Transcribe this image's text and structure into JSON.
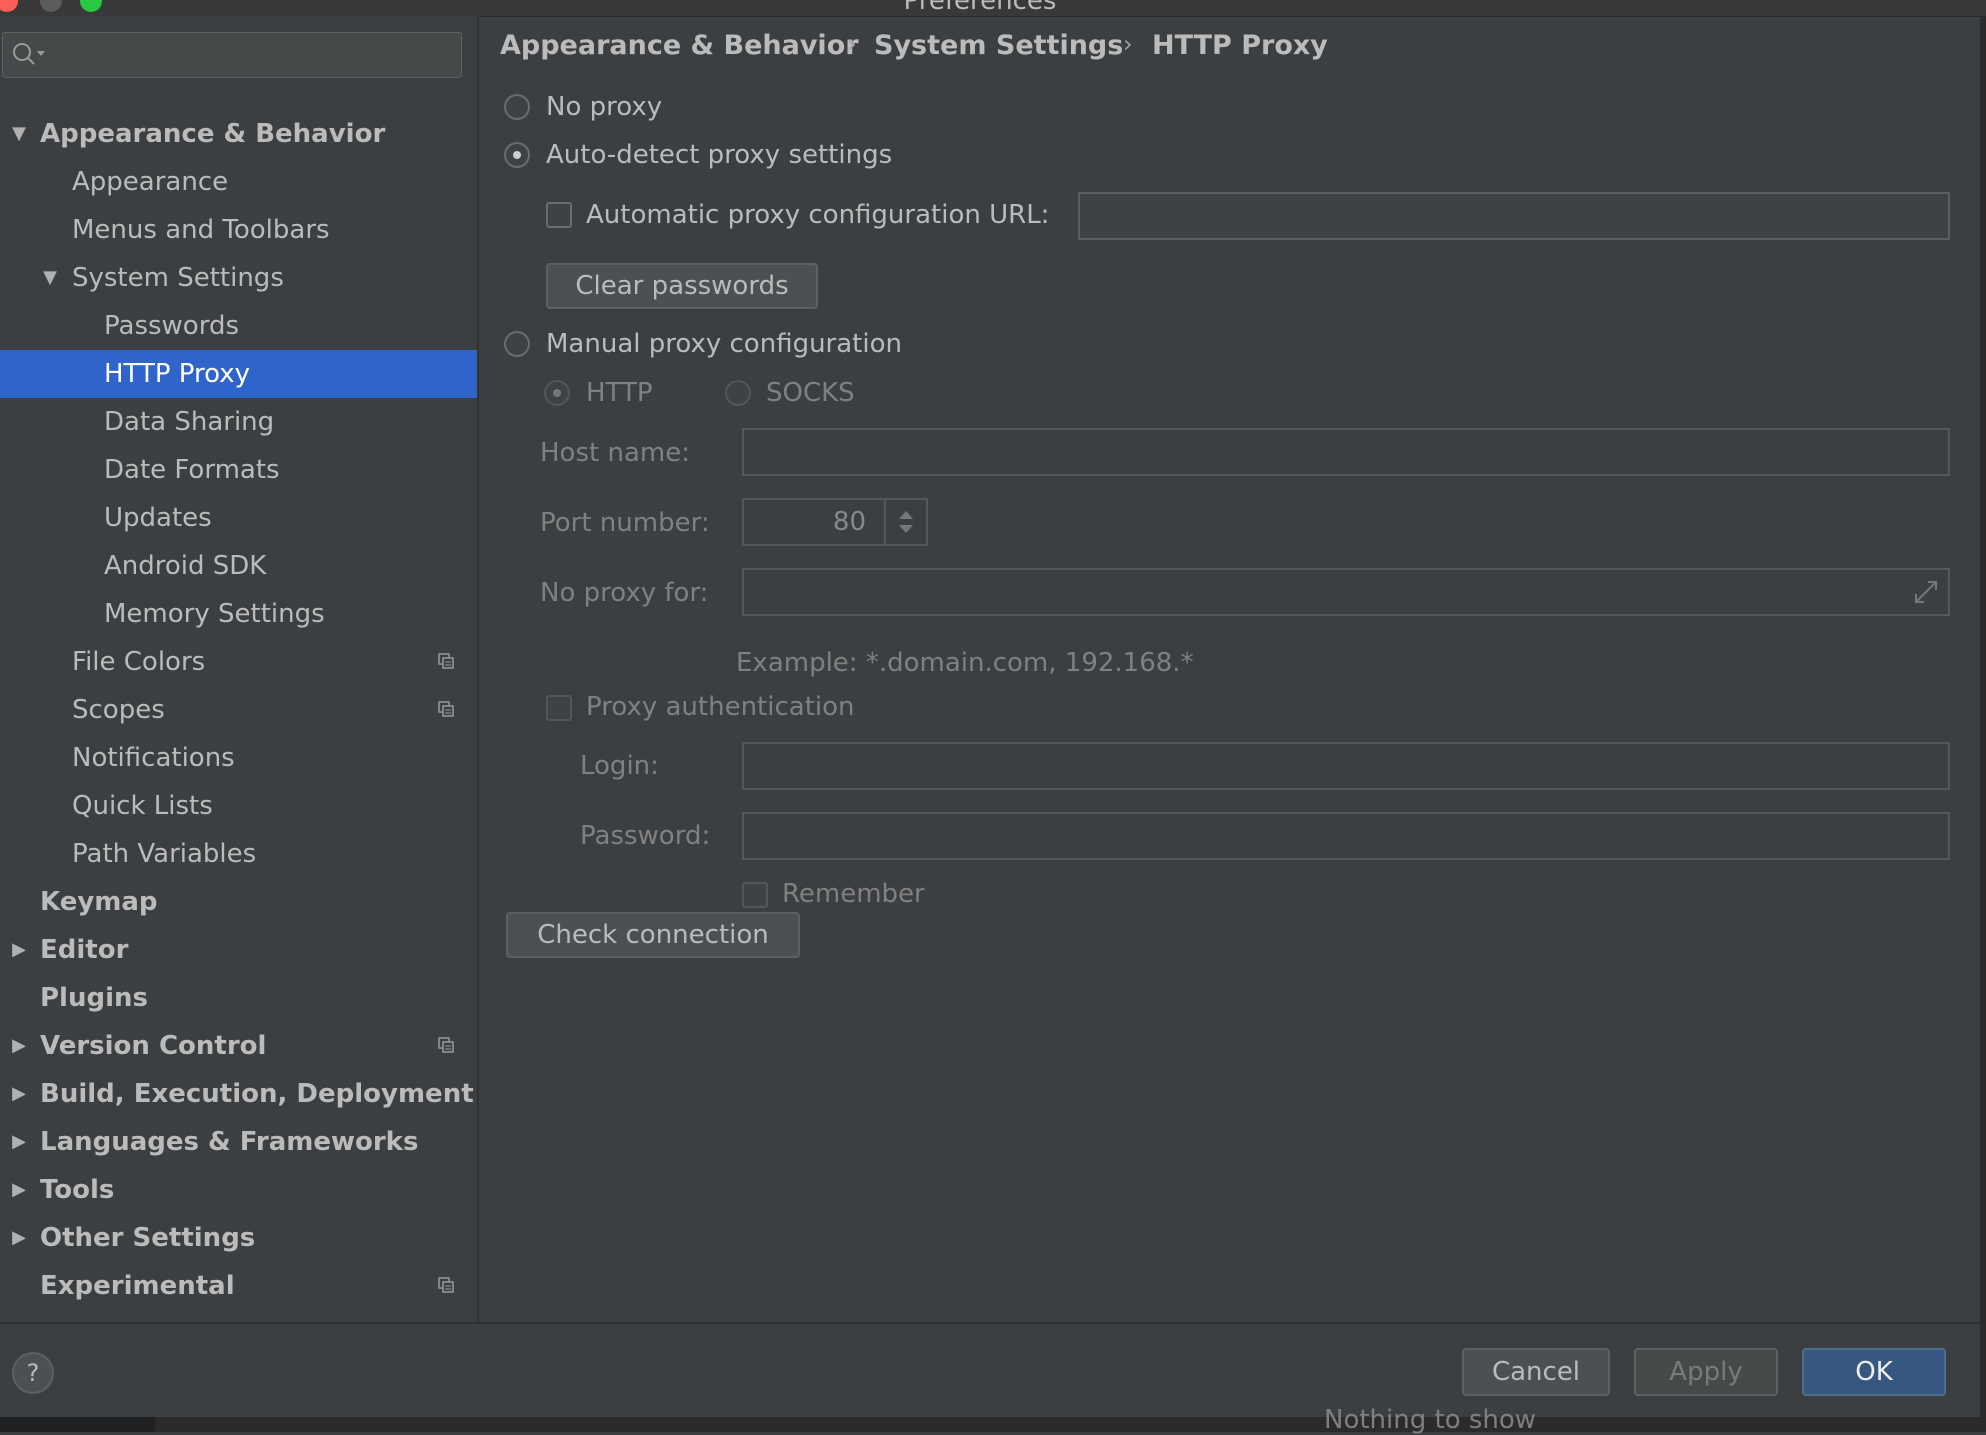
{
  "window": {
    "title": "Preferences"
  },
  "search": {
    "placeholder": ""
  },
  "tree": [
    {
      "label": "Appearance & Behavior",
      "bold": true,
      "level": 0,
      "arrow": "down",
      "proj": false,
      "selected": false
    },
    {
      "label": "Appearance",
      "bold": false,
      "level": 1,
      "arrow": "",
      "proj": false,
      "selected": false
    },
    {
      "label": "Menus and Toolbars",
      "bold": false,
      "level": 1,
      "arrow": "",
      "proj": false,
      "selected": false
    },
    {
      "label": "System Settings",
      "bold": false,
      "level": 1,
      "arrow": "down",
      "proj": false,
      "selected": false
    },
    {
      "label": "Passwords",
      "bold": false,
      "level": 2,
      "arrow": "",
      "proj": false,
      "selected": false
    },
    {
      "label": "HTTP Proxy",
      "bold": false,
      "level": 2,
      "arrow": "",
      "proj": false,
      "selected": true
    },
    {
      "label": "Data Sharing",
      "bold": false,
      "level": 2,
      "arrow": "",
      "proj": false,
      "selected": false
    },
    {
      "label": "Date Formats",
      "bold": false,
      "level": 2,
      "arrow": "",
      "proj": false,
      "selected": false
    },
    {
      "label": "Updates",
      "bold": false,
      "level": 2,
      "arrow": "",
      "proj": false,
      "selected": false
    },
    {
      "label": "Android SDK",
      "bold": false,
      "level": 2,
      "arrow": "",
      "proj": false,
      "selected": false
    },
    {
      "label": "Memory Settings",
      "bold": false,
      "level": 2,
      "arrow": "",
      "proj": false,
      "selected": false
    },
    {
      "label": "File Colors",
      "bold": false,
      "level": 1,
      "arrow": "",
      "proj": true,
      "selected": false
    },
    {
      "label": "Scopes",
      "bold": false,
      "level": 1,
      "arrow": "",
      "proj": true,
      "selected": false
    },
    {
      "label": "Notifications",
      "bold": false,
      "level": 1,
      "arrow": "",
      "proj": false,
      "selected": false
    },
    {
      "label": "Quick Lists",
      "bold": false,
      "level": 1,
      "arrow": "",
      "proj": false,
      "selected": false
    },
    {
      "label": "Path Variables",
      "bold": false,
      "level": 1,
      "arrow": "",
      "proj": false,
      "selected": false
    },
    {
      "label": "Keymap",
      "bold": true,
      "level": 0,
      "arrow": "",
      "proj": false,
      "selected": false
    },
    {
      "label": "Editor",
      "bold": true,
      "level": 0,
      "arrow": "right",
      "proj": false,
      "selected": false
    },
    {
      "label": "Plugins",
      "bold": true,
      "level": 0,
      "arrow": "",
      "proj": false,
      "selected": false
    },
    {
      "label": "Version Control",
      "bold": true,
      "level": 0,
      "arrow": "right",
      "proj": true,
      "selected": false
    },
    {
      "label": "Build, Execution, Deployment",
      "bold": true,
      "level": 0,
      "arrow": "right",
      "proj": false,
      "selected": false
    },
    {
      "label": "Languages & Frameworks",
      "bold": true,
      "level": 0,
      "arrow": "right",
      "proj": false,
      "selected": false
    },
    {
      "label": "Tools",
      "bold": true,
      "level": 0,
      "arrow": "right",
      "proj": false,
      "selected": false
    },
    {
      "label": "Other Settings",
      "bold": true,
      "level": 0,
      "arrow": "right",
      "proj": false,
      "selected": false
    },
    {
      "label": "Experimental",
      "bold": true,
      "level": 0,
      "arrow": "",
      "proj": true,
      "selected": false
    }
  ],
  "breadcrumb": [
    "Appearance & Behavior",
    "System Settings",
    "HTTP Proxy"
  ],
  "breadcrumb_separator": "›",
  "proxy": {
    "no_proxy": "No proxy",
    "auto_detect": "Auto-detect proxy settings",
    "auto_config_url_label": "Automatic proxy configuration URL:",
    "auto_config_url_value": "",
    "clear_passwords": "Clear passwords",
    "manual": "Manual proxy configuration",
    "http": "HTTP",
    "socks": "SOCKS",
    "host_label": "Host name:",
    "host_value": "",
    "port_label": "Port number:",
    "port_value": "80",
    "no_proxy_for_label": "No proxy for:",
    "no_proxy_for_value": "",
    "example": "Example: *.domain.com, 192.168.*",
    "proxy_auth": "Proxy authentication",
    "login_label": "Login:",
    "login_value": "",
    "password_label": "Password:",
    "password_value": "",
    "remember": "Remember",
    "check_connection": "Check connection",
    "selected_mode": "auto_detect",
    "selected_protocol": "http"
  },
  "footer": {
    "help": "?",
    "cancel": "Cancel",
    "apply": "Apply",
    "ok": "OK"
  },
  "background_status": "Nothing to show",
  "colors": {
    "selection": "#2f65ca",
    "panel": "#3c3f41",
    "primary_button": "#365880"
  }
}
